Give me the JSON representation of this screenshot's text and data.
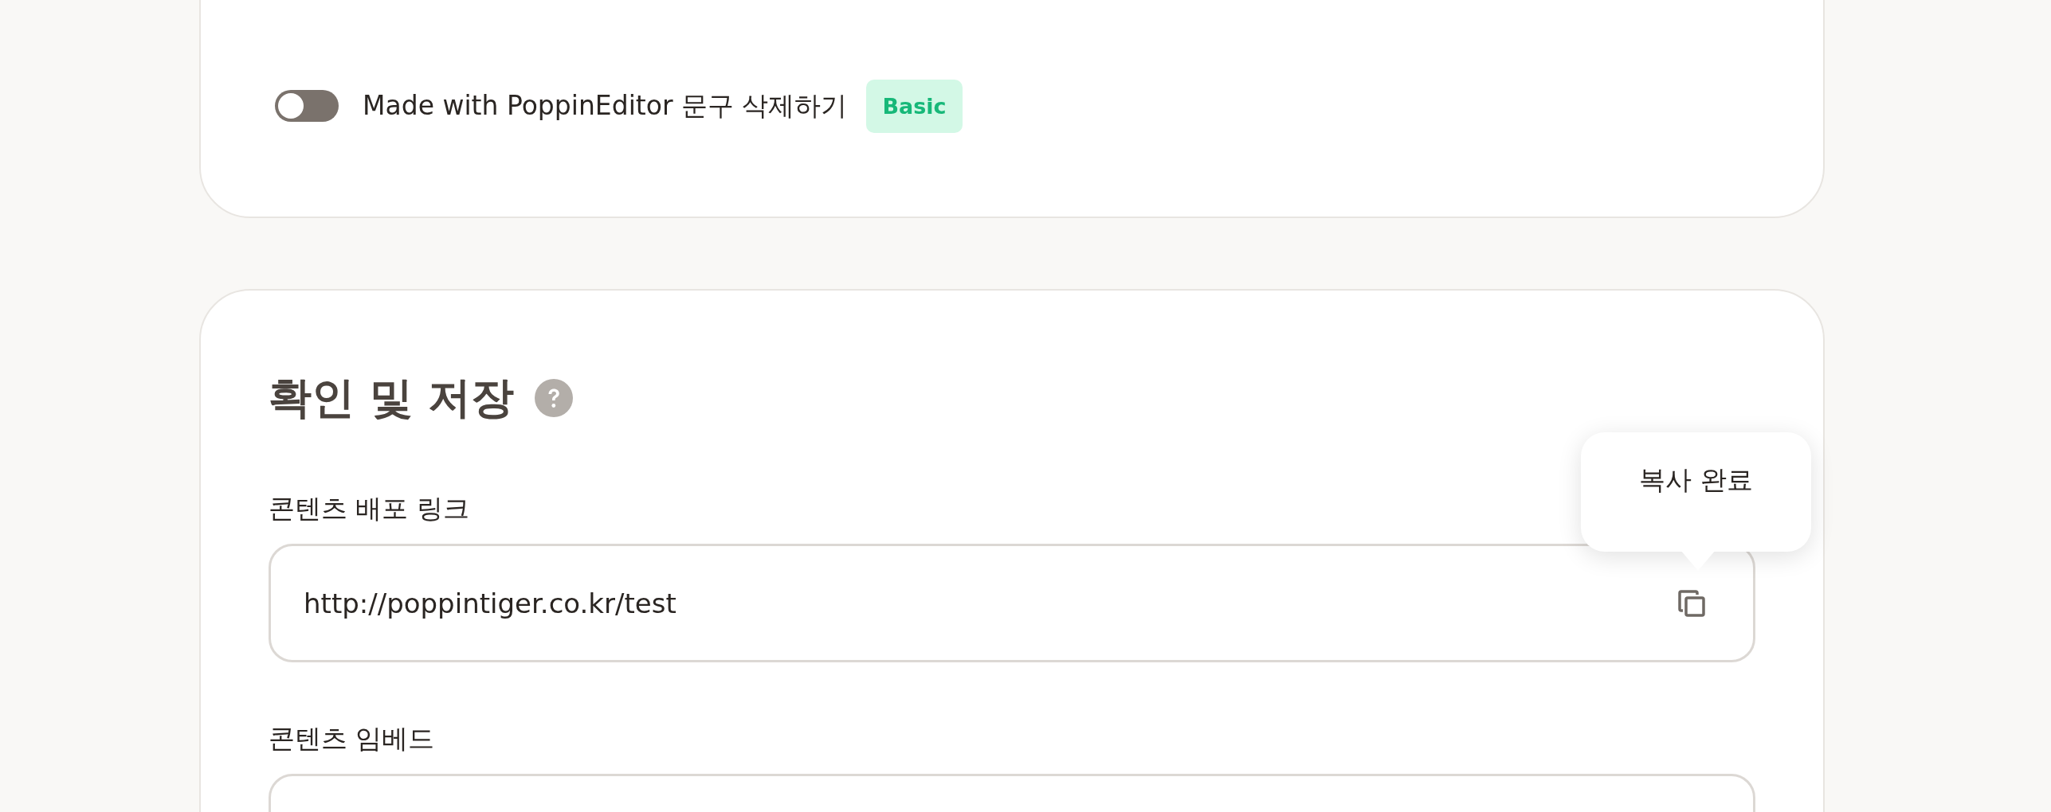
{
  "promo": {
    "toggle": {
      "label": "Made with PoppinEditor 문구 삭제하기",
      "on": false
    },
    "badge": "Basic"
  },
  "publish": {
    "title": "확인 및 저장",
    "fields": [
      {
        "label": "콘텐츠 배포 링크",
        "value": "http://poppintiger.co.kr/test",
        "tooltip": "복사 완료"
      },
      {
        "label": "콘텐츠 임베드"
      }
    ]
  }
}
